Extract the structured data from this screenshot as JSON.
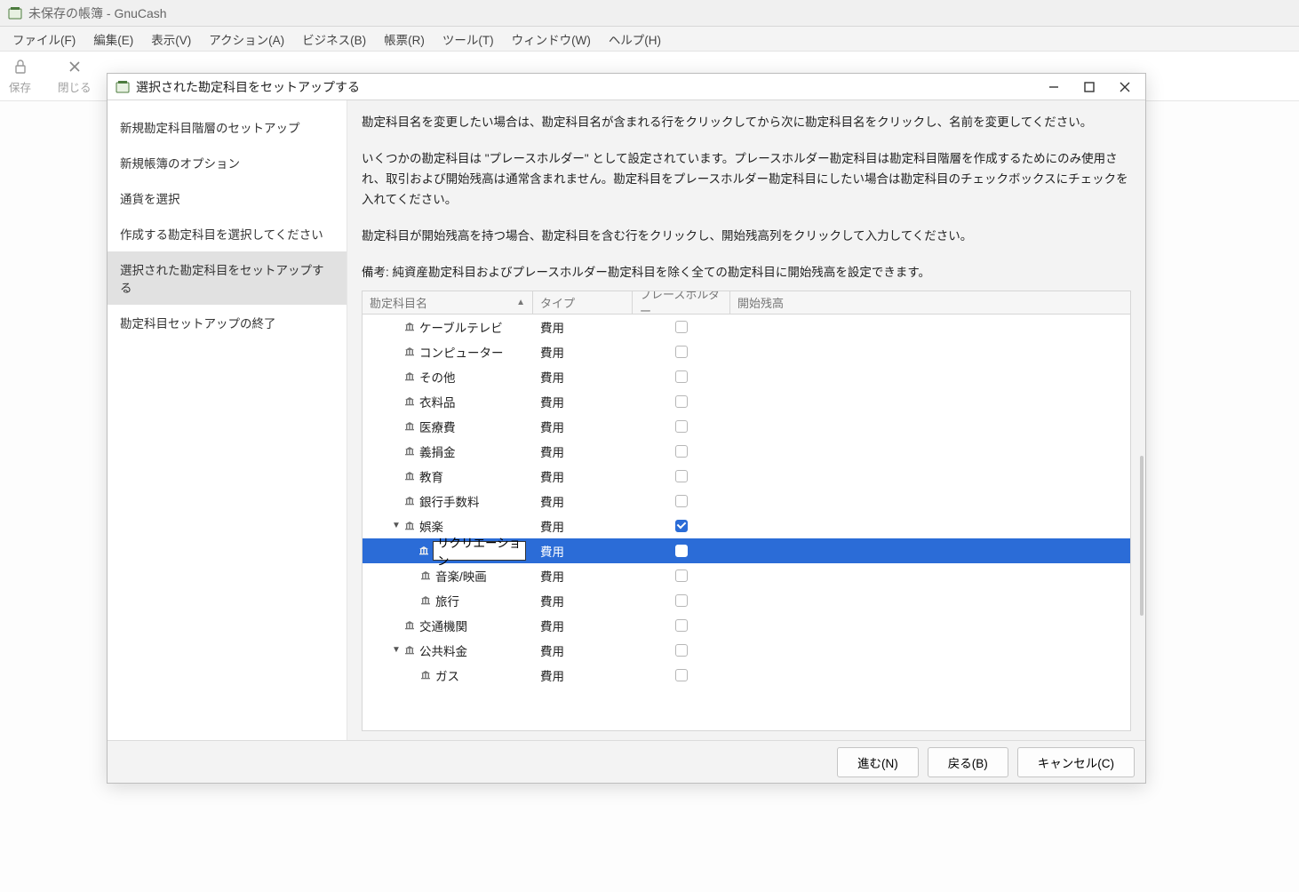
{
  "main": {
    "title": "未保存の帳簿 - GnuCash",
    "menus": [
      "ファイル(F)",
      "編集(E)",
      "表示(V)",
      "アクション(A)",
      "ビジネス(B)",
      "帳票(R)",
      "ツール(T)",
      "ウィンドウ(W)",
      "ヘルプ(H)"
    ],
    "toolbar": {
      "save": "保存",
      "close": "閉じる"
    }
  },
  "dialog": {
    "title": "選択された勘定科目をセットアップする",
    "steps": [
      "新規勘定科目階層のセットアップ",
      "新規帳簿のオプション",
      "通貨を選択",
      "作成する勘定科目を選択してください",
      "選択された勘定科目をセットアップする",
      "勘定科目セットアップの終了"
    ],
    "active_step": 4,
    "paragraphs": [
      "勘定科目名を変更したい場合は、勘定科目名が含まれる行をクリックしてから次に勘定科目名をクリックし、名前を変更してください。",
      "いくつかの勘定科目は \"プレースホルダー\" として設定されています。プレースホルダー勘定科目は勘定科目階層を作成するためにのみ使用され、取引および開始残高は通常含まれません。勘定科目をプレースホルダー勘定科目にしたい場合は勘定科目のチェックボックスにチェックを入れてください。",
      "勘定科目が開始残高を持つ場合、勘定科目を含む行をクリックし、開始残高列をクリックして入力してください。",
      "備考: 純資産勘定科目およびプレースホルダー勘定科目を除く全ての勘定科目に開始残高を設定できます。"
    ],
    "columns": {
      "name": "勘定科目名",
      "type": "タイプ",
      "placeholder": "プレースホルダー",
      "balance": "開始残高"
    },
    "rows": [
      {
        "indent": 1,
        "expander": "",
        "name": "ケーブルテレビ",
        "type": "費用",
        "ph": false,
        "selected": false
      },
      {
        "indent": 1,
        "expander": "",
        "name": "コンピューター",
        "type": "費用",
        "ph": false,
        "selected": false
      },
      {
        "indent": 1,
        "expander": "",
        "name": "その他",
        "type": "費用",
        "ph": false,
        "selected": false
      },
      {
        "indent": 1,
        "expander": "",
        "name": "衣料品",
        "type": "費用",
        "ph": false,
        "selected": false
      },
      {
        "indent": 1,
        "expander": "",
        "name": "医療費",
        "type": "費用",
        "ph": false,
        "selected": false
      },
      {
        "indent": 1,
        "expander": "",
        "name": "義捐金",
        "type": "費用",
        "ph": false,
        "selected": false
      },
      {
        "indent": 1,
        "expander": "",
        "name": "教育",
        "type": "費用",
        "ph": false,
        "selected": false
      },
      {
        "indent": 1,
        "expander": "",
        "name": "銀行手数料",
        "type": "費用",
        "ph": false,
        "selected": false
      },
      {
        "indent": 1,
        "expander": "▼",
        "name": "娯楽",
        "type": "費用",
        "ph": true,
        "selected": false
      },
      {
        "indent": 2,
        "expander": "",
        "name": "リクリエーション",
        "type": "費用",
        "ph": false,
        "selected": true,
        "editing": true
      },
      {
        "indent": 2,
        "expander": "",
        "name": "音楽/映画",
        "type": "費用",
        "ph": false,
        "selected": false
      },
      {
        "indent": 2,
        "expander": "",
        "name": "旅行",
        "type": "費用",
        "ph": false,
        "selected": false
      },
      {
        "indent": 1,
        "expander": "",
        "name": "交通機関",
        "type": "費用",
        "ph": false,
        "selected": false
      },
      {
        "indent": 1,
        "expander": "▼",
        "name": "公共料金",
        "type": "費用",
        "ph": false,
        "selected": false
      },
      {
        "indent": 2,
        "expander": "",
        "name": "ガス",
        "type": "費用",
        "ph": false,
        "selected": false
      }
    ],
    "buttons": {
      "next": "進む(N)",
      "back": "戻る(B)",
      "cancel": "キャンセル(C)"
    }
  }
}
